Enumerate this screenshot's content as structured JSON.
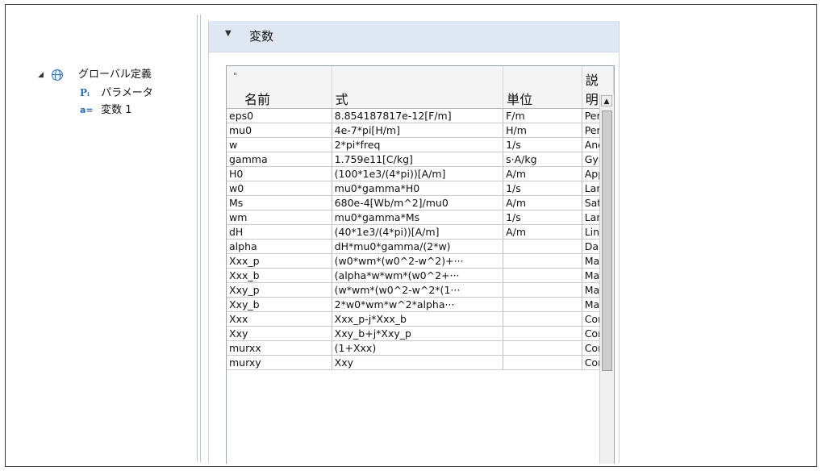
{
  "tree": {
    "root": {
      "expander": "◢",
      "label": "グローバル定義"
    },
    "children": [
      {
        "icon": "Pᵢ",
        "label": "パラメータ"
      },
      {
        "icon": "a=",
        "label": "変数 1"
      }
    ]
  },
  "section": {
    "caret": "▼",
    "title": "変数"
  },
  "table": {
    "name_mark": "\"",
    "columns": [
      "名前",
      "式",
      "単位",
      "説明"
    ],
    "rows": [
      [
        "eps0",
        "8.854187817e-12[F/m]",
        "F/m",
        "Per"
      ],
      [
        "mu0",
        "4e-7*pi[H/m]",
        "H/m",
        "Per"
      ],
      [
        "w",
        "2*pi*freq",
        "1/s",
        "Ang"
      ],
      [
        "gamma",
        "1.759e11[C/kg]",
        "s·A/kg",
        "Gyr"
      ],
      [
        "H0",
        "(100*1e3/(4*pi))[A/m]",
        "A/m",
        "App"
      ],
      [
        "w0",
        "mu0*gamma*H0",
        "1/s",
        "Ları"
      ],
      [
        "Ms",
        "680e-4[Wb/m^2]/mu0",
        "A/m",
        "Sat"
      ],
      [
        "wm",
        "mu0*gamma*Ms",
        "1/s",
        "Ları"
      ],
      [
        "dH",
        "(40*1e3/(4*pi))[A/m]",
        "A/m",
        "Line"
      ],
      [
        "alpha",
        "dH*mu0*gamma/(2*w)",
        "",
        "Dar"
      ],
      [
        "Xxx_p",
        "(w0*wm*(w0^2-w^2)+···",
        "",
        "Mag"
      ],
      [
        "Xxx_b",
        "(alpha*w*wm*(w0^2+···",
        "",
        "Mag"
      ],
      [
        "Xxy_p",
        "(w*wm*(w0^2-w^2*(1···",
        "",
        "Mag"
      ],
      [
        "Xxy_b",
        "2*w0*wm*w^2*alpha···",
        "",
        "Mag"
      ],
      [
        "Xxx",
        "Xxx_p-j*Xxx_b",
        "",
        "Cor"
      ],
      [
        "Xxy",
        "Xxy_b+j*Xxy_p",
        "",
        "Cor"
      ],
      [
        "murxx",
        "(1+Xxx)",
        "",
        "Cor"
      ],
      [
        "murxy",
        "Xxy",
        "",
        "Cor"
      ]
    ]
  },
  "scrollbar": {
    "up_arrow": "▲"
  }
}
